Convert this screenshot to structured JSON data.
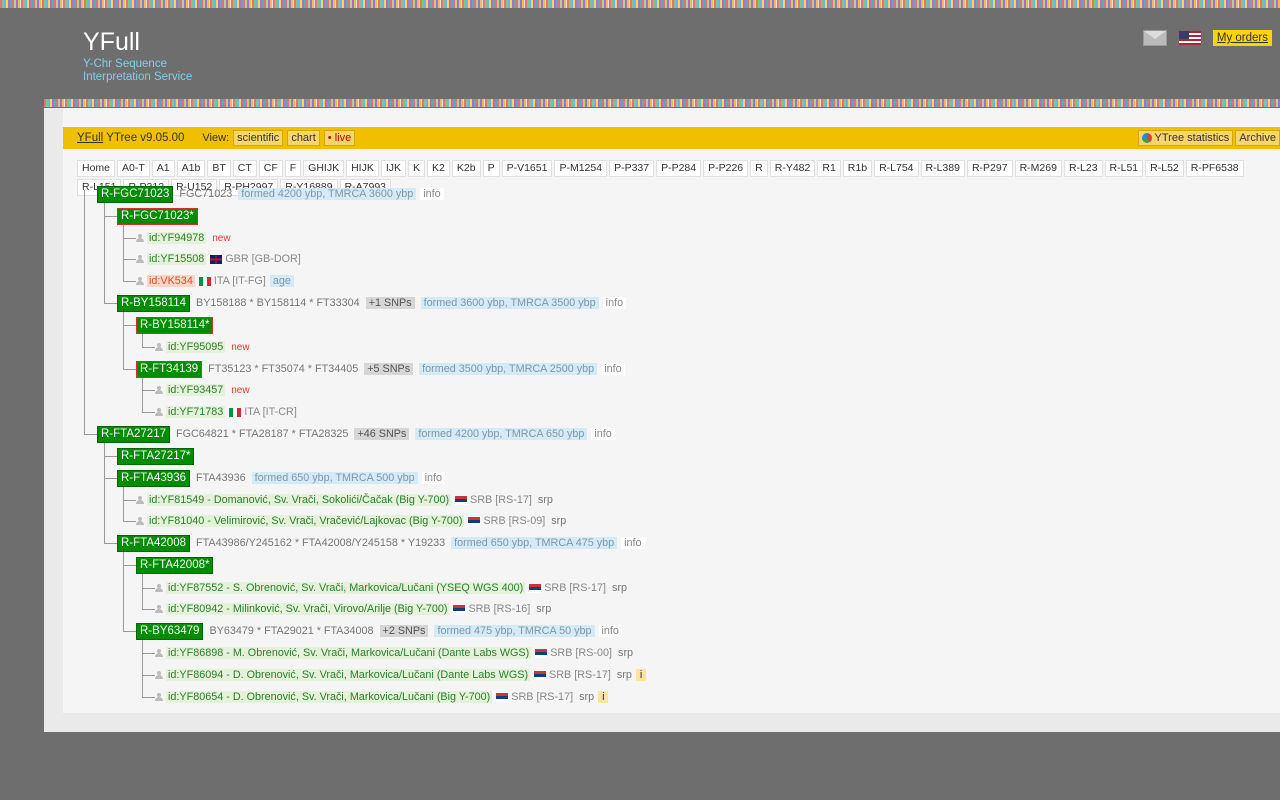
{
  "brand": {
    "title": "YFull",
    "subtitle": "Y-Chr Sequence Interpretation Service"
  },
  "header": {
    "my_orders": "My orders",
    "icons": [
      "mail-icon",
      "us-flag-icon"
    ]
  },
  "toolbar": {
    "yfull": "YFull",
    "version": "YTree v9.05.00",
    "view_label": "View:",
    "scientific": "scientific",
    "chart": "chart",
    "live": "• live",
    "stats": "YTree statistics",
    "archive": "Archive"
  },
  "nav": [
    "Home",
    "A0-T",
    "A1",
    "A1b",
    "BT",
    "CT",
    "CF",
    "F",
    "GHIJK",
    "HIJK",
    "IJK",
    "K",
    "K2",
    "K2b",
    "P",
    "P-V1651",
    "P-M1254",
    "P-P337",
    "P-P284",
    "P-P226",
    "R",
    "R-Y482",
    "R1",
    "R1b",
    "R-L754",
    "R-L389",
    "R-P297",
    "R-M269",
    "R-L23",
    "R-L51",
    "R-L52",
    "R-PF6538",
    "R-L151",
    "R-P312",
    "R-U152",
    "R-PH2997",
    "R-Y16889",
    "R-A7993"
  ],
  "rows": [
    {
      "type": "node",
      "name": "R-FGC71023",
      "snps": "FGC71023",
      "formed": "formed 4200 ybp, TMRCA 3600 ybp",
      "info": "info"
    },
    {
      "type": "node",
      "name": "R-FGC71023*",
      "star": true
    },
    {
      "type": "sample",
      "id": "id:YF94978",
      "new": "new"
    },
    {
      "type": "sample",
      "id": "id:YF15508",
      "flag": "gb",
      "geo": "GBR [GB-DOR]"
    },
    {
      "type": "sample",
      "id": "id:VK534",
      "old": true,
      "flag": "it",
      "geo": "ITA [IT-FG]",
      "age": "age"
    },
    {
      "type": "node",
      "name": "R-BY158114",
      "snps": "BY158188 * BY158114 * FT33304",
      "cnt": "+1 SNPs",
      "formed": "formed 3600 ybp, TMRCA 3500 ybp",
      "info": "info"
    },
    {
      "type": "node",
      "name": "R-BY158114*",
      "star": true
    },
    {
      "type": "sample",
      "id": "id:YF95095",
      "new": "new"
    },
    {
      "type": "node",
      "name": "R-FT34139",
      "star": true,
      "snps": "FT35123 * FT35074 * FT34405",
      "cnt": "+5 SNPs",
      "formed": "formed 3500 ybp, TMRCA 2500 ybp",
      "info": "info"
    },
    {
      "type": "sample",
      "id": "id:YF93457",
      "new": "new"
    },
    {
      "type": "sample",
      "id": "id:YF71783",
      "flag": "it",
      "geo": "ITA [IT-CR]"
    },
    {
      "type": "node",
      "name": "R-FTA27217",
      "snps": "FGC64821 * FTA28187 * FTA28325",
      "cnt": "+46 SNPs",
      "formed": "formed 4200 ybp, TMRCA 650 ybp",
      "info": "info"
    },
    {
      "type": "node",
      "name": "R-FTA27217*"
    },
    {
      "type": "node",
      "name": "R-FTA43936",
      "snps": "FTA43936",
      "formed": "formed 650 ybp, TMRCA 500 ybp",
      "info": "info"
    },
    {
      "type": "sample",
      "id": "id:YF81549 - Domanović, Sv. Vrači, Sokolići/Čačak (Big Y-700)",
      "flag": "rs",
      "geo": "SRB [RS-17]",
      "srp": "srp"
    },
    {
      "type": "sample",
      "id": "id:YF81040 - Velimirović, Sv. Vrači, Vračević/Lajkovac (Big Y-700)",
      "flag": "rs",
      "geo": "SRB [RS-09]",
      "srp": "srp"
    },
    {
      "type": "node",
      "name": "R-FTA42008",
      "snps": "FTA43986/Y245162 * FTA42008/Y245158 * Y19233",
      "formed": "formed 650 ybp, TMRCA 475 ybp",
      "info": "info"
    },
    {
      "type": "node",
      "name": "R-FTA42008*"
    },
    {
      "type": "sample",
      "id": "id:YF87552 - S. Obrenović, Sv. Vrači, Markovica/Lučani (YSEQ WGS 400)",
      "flag": "rs",
      "geo": "SRB [RS-17]",
      "srp": "srp"
    },
    {
      "type": "sample",
      "id": "id:YF80942 - Milinković, Sv. Vrači, Virovo/Arilje (Big Y-700)",
      "flag": "rs",
      "geo": "SRB [RS-16]",
      "srp": "srp"
    },
    {
      "type": "node",
      "name": "R-BY63479",
      "snps": "BY63479 * FTA29021 * FTA34008",
      "cnt": "+2 SNPs",
      "formed": "formed 475 ybp, TMRCA 50 ybp",
      "info": "info"
    },
    {
      "type": "sample",
      "id": "id:YF86898 - M. Obrenović, Sv. Vrači, Markovica/Lučani (Dante Labs WGS)",
      "flag": "rs",
      "geo": "SRB [RS-00]",
      "srp": "srp"
    },
    {
      "type": "sample",
      "id": "id:YF86094 - D. Obrenović, Sv. Vrači, Markovica/Lučani (Dante Labs WGS)",
      "flag": "rs",
      "geo": "SRB [RS-17]",
      "srp": "srp",
      "ibadge": "i"
    },
    {
      "type": "sample",
      "id": "id:YF80654 - D. Obrenović, Sv. Vrači, Markovica/Lučani (Big Y-700)",
      "flag": "rs",
      "geo": "SRB [RS-17]",
      "srp": "srp",
      "ibadge": "i"
    }
  ]
}
